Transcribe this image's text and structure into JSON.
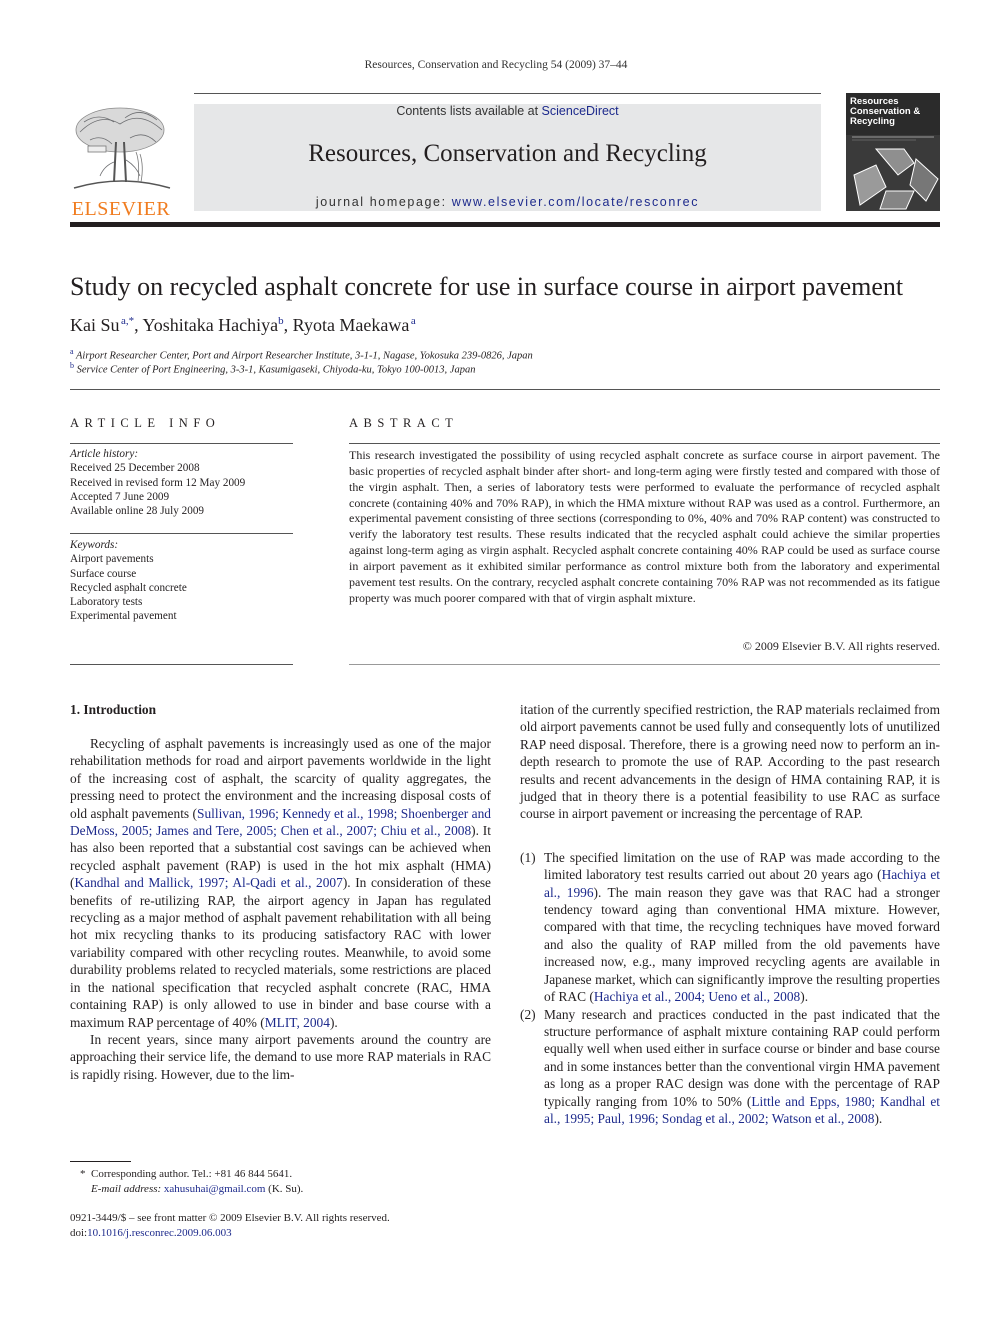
{
  "running_head": "Resources, Conservation and Recycling 54 (2009) 37–44",
  "masthead": {
    "publisher_logo_text": "ELSEVIER",
    "contents_prefix": "Contents lists available at ",
    "contents_link": "ScienceDirect",
    "journal_title": "Resources, Conservation and Recycling",
    "homepage_prefix": "journal homepage: ",
    "homepage_link": "www.elsevier.com/locate/resconrec",
    "cover_title_lines": [
      "Resources",
      "Conservation &",
      "Recycling"
    ],
    "colors": {
      "publisher_orange": "#f07c1f",
      "link_blue": "#1d2a8c",
      "banner_gray": "#e6e7e8"
    }
  },
  "article": {
    "title": "Study on recycled asphalt concrete for use in surface course in airport pavement",
    "authors": [
      {
        "name": "Kai Su",
        "sup": "a,*",
        "sep": ", "
      },
      {
        "name": "Yoshitaka Hachiya",
        "sup": "b",
        "sep": ", "
      },
      {
        "name": "Ryota Maekawa",
        "sup": "a",
        "sep": ""
      }
    ],
    "affiliations": [
      {
        "mark": "a",
        "text": "Airport Researcher Center, Port and Airport Researcher Institute, 3-1-1, Nagase, Yokosuka 239-0826, Japan"
      },
      {
        "mark": "b",
        "text": "Service Center of Port Engineering, 3-3-1, Kasumigaseki, Chiyoda-ku, Tokyo 100-0013, Japan"
      }
    ]
  },
  "article_info": {
    "heading": "ARTICLE INFO",
    "history_label": "Article history:",
    "history": [
      "Received 25 December 2008",
      "Received in revised form 12 May 2009",
      "Accepted 7 June 2009",
      "Available online 28 July 2009"
    ],
    "keywords_label": "Keywords:",
    "keywords": [
      "Airport pavements",
      "Surface course",
      "Recycled asphalt concrete",
      "Laboratory tests",
      "Experimental pavement"
    ]
  },
  "abstract": {
    "heading": "ABSTRACT",
    "text": "This research investigated the possibility of using recycled asphalt concrete as surface course in airport pavement. The basic properties of recycled asphalt binder after short- and long-term aging were firstly tested and compared with those of the virgin asphalt. Then, a series of laboratory tests were performed to evaluate the performance of recycled asphalt concrete (containing 40% and 70% RAP), in which the HMA mixture without RAP was used as a control. Furthermore, an experimental pavement consisting of three sections (corresponding to 0%, 40% and 70% RAP content) was constructed to verify the laboratory test results. These results indicated that the recycled asphalt could achieve the similar properties against long-term aging as virgin asphalt. Recycled asphalt concrete containing 40% RAP could be used as surface course in airport pavement as it exhibited similar performance as control mixture both from the laboratory and experimental pavement test results. On the contrary, recycled asphalt concrete containing 70% RAP was not recommended as its fatigue property was much poorer compared with that of virgin asphalt mixture.",
    "copyright": "© 2009 Elsevier B.V. All rights reserved."
  },
  "introduction": {
    "heading": "1.  Introduction",
    "p1": {
      "t1": "Recycling of asphalt pavements is increasingly used as one of the major rehabilitation methods for road and airport pavements worldwide in the light of the increasing cost of asphalt, the scarcity of quality aggregates, the pressing need to protect the environment and the increasing disposal costs of old asphalt pavements (",
      "c1": "Sullivan, 1996; Kennedy et al., 1998; Shoenberger and DeMoss, 2005; James and Tere, 2005; Chen et al., 2007; Chiu et al., 2008",
      "t2": "). It has also been reported that a substantial cost savings can be achieved when recycled asphalt pavement (RAP) is used in the hot mix asphalt (HMA) (",
      "c2": "Kandhal and Mallick, 1997; Al-Qadi et al., 2007",
      "t3": "). In consideration of these benefits of re-utilizing RAP, the airport agency in Japan has regulated recycling as a major method of asphalt pavement rehabilitation with all being hot mix recycling thanks to its producing satisfactory RAC with lower variability compared with other recycling routes. Meanwhile, to avoid some durability problems related to recycled materials, some restrictions are placed in the national specification that recycled asphalt concrete (RAC, HMA containing RAP) is only allowed to use in binder and base course with a maximum RAP percentage of 40% (",
      "c3": "MLIT, 2004",
      "t4": ")."
    },
    "p2": "In recent years, since many airport pavements around the country are approaching their service life, the demand to use more RAP materials in RAC is rapidly rising. However, due to the limitation of the currently specified restriction, the RAP materials reclaimed from old airport pavements cannot be used fully and consequently lots of unutilized RAP need disposal. Therefore, there is a growing need now to perform an in-depth research to promote the use of RAP. According to the past research results and recent advancements in the design of HMA containing RAP, it is judged that in theory there is a potential feasibility to use RAC as surface course in airport pavement or increasing the percentage of RAP.",
    "p2_left": "In recent years, since many airport pavements around the country are approaching their service life, the demand to use more RAP materials in RAC is rapidly rising. However, due to the lim-",
    "p2_right": "itation of the currently specified restriction, the RAP materials reclaimed from old airport pavements cannot be used fully and consequently lots of unutilized RAP need disposal. Therefore, there is a growing need now to perform an in-depth research to promote the use of RAP. According to the past research results and recent advancements in the design of HMA containing RAP, it is judged that in theory there is a potential feasibility to use RAC as surface course in airport pavement or increasing the percentage of RAP.",
    "list": [
      {
        "num": "(1)",
        "t1": "The specified limitation on the use of RAP was made according to the limited laboratory test results carried out about 20 years ago (",
        "c1": "Hachiya et al., 1996",
        "t2": "). The main reason they gave was that RAC had a stronger tendency toward aging than conventional HMA mixture. However, compared with that time, the recycling techniques have moved forward and also the quality of RAP milled from the old pavements have increased now, e.g., many improved recycling agents are available in Japanese market, which can significantly improve the resulting properties of RAC (",
        "c2": "Hachiya et al., 2004; Ueno et al., 2008",
        "t3": ")."
      },
      {
        "num": "(2)",
        "t1": "Many research and practices conducted in the past indicated that the structure performance of asphalt mixture containing RAP could perform equally well when used either in surface course or binder and base course and in some instances better than the conventional virgin HMA pavement as long as a proper RAC design was done with the percentage of RAP typically ranging from 10% to 50% (",
        "c1": "Little and Epps, 1980; Kandhal et al., 1995; Paul, 1996; Sondag et al., 2002; Watson et al., 2008",
        "t2": ").",
        "c2": "",
        "t3": ""
      }
    ]
  },
  "footnote": {
    "mark": "*",
    "corresponding": "Corresponding author. Tel.: +81 46 844 5641.",
    "email_label": "E-mail address: ",
    "email": "xahusuhai@gmail.com",
    "email_suffix": " (K. Su)."
  },
  "footer": {
    "issn_line": "0921-3449/$ – see front matter © 2009 Elsevier B.V. All rights reserved.",
    "doi_prefix": "doi:",
    "doi": "10.1016/j.resconrec.2009.06.003"
  }
}
